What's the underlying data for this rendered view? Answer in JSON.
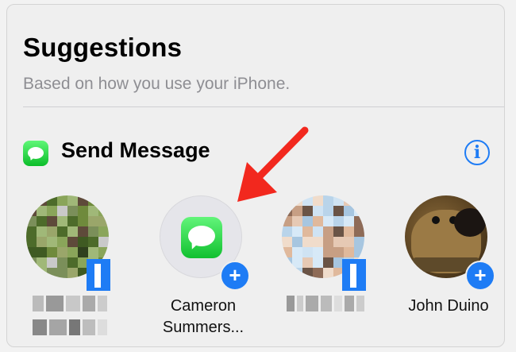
{
  "suggestions": {
    "title": "Suggestions",
    "subtitle": "Based on how you use your iPhone."
  },
  "section": {
    "title": "Send Message",
    "app_icon": "messages-icon",
    "info_icon": "info-icon",
    "info_glyph": "i"
  },
  "contacts": [
    {
      "name": "",
      "redacted": true,
      "avatar": "pixelated-photo"
    },
    {
      "name": "Cameron Summers...",
      "line1": "Cameron",
      "line2": "Summers...",
      "avatar": "messages-icon"
    },
    {
      "name": "",
      "redacted": true,
      "avatar": "pixelated-photo"
    },
    {
      "name": "John Duino",
      "avatar": "dog-photo"
    }
  ],
  "badge": {
    "glyph": "+",
    "icon": "plus-icon"
  },
  "annotation": {
    "icon": "red-arrow-icon",
    "color": "#f2281e"
  },
  "colors": {
    "accent": "#1e7cf5",
    "messages_green": "#2dd24b",
    "arrow": "#f2281e"
  }
}
